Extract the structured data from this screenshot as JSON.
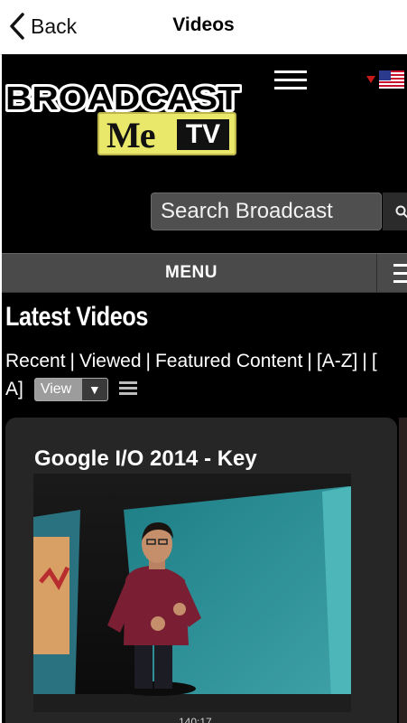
{
  "nav": {
    "back_label": "Back",
    "title": "Videos"
  },
  "site": {
    "logo_top": "BROADCAST",
    "logo_me": "Me",
    "logo_tv": "TV",
    "search_value": "Search Broadcast",
    "menu_label": "MENU"
  },
  "content": {
    "heading": "Latest Videos",
    "tabs": [
      "Recent",
      "Viewed",
      "Featured Content",
      "[A-Z]",
      "["
    ],
    "tab_sep": "|",
    "row2_text": "A]",
    "view_select": "View"
  },
  "video": {
    "title": "Google I/O 2014 - Key",
    "duration": "140:17"
  },
  "colors": {
    "logo_yellow": "#e9e86a",
    "menu_bar": "#4a4a4a",
    "card_bg": "#262626"
  }
}
